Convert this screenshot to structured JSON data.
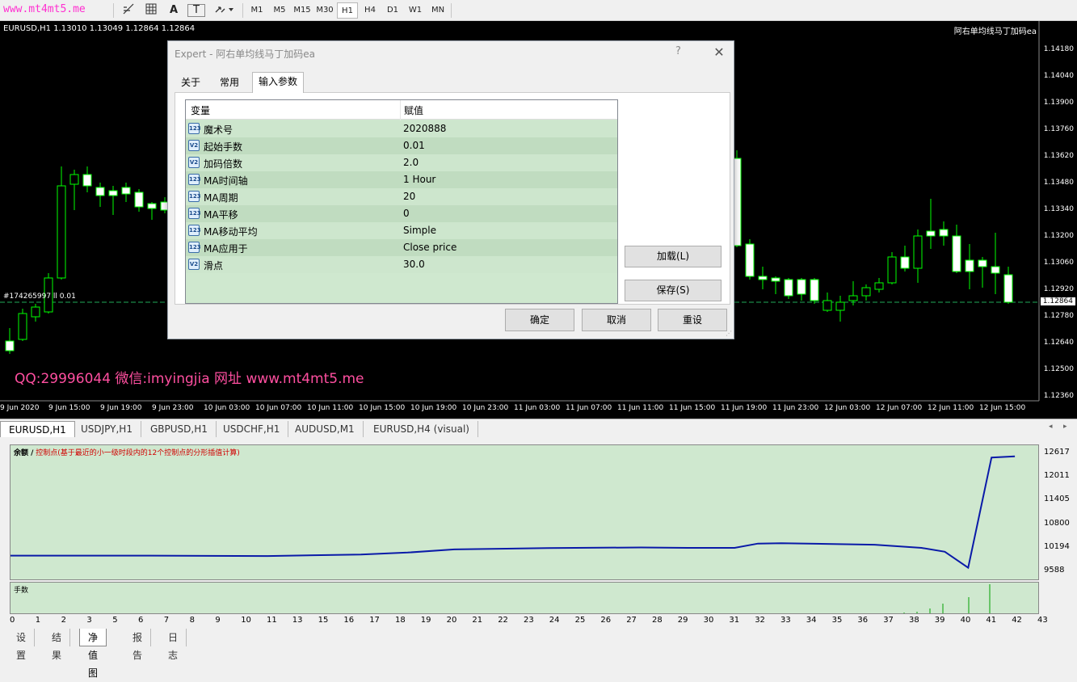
{
  "toolbar": {
    "watermark": "www.mt4mt5.me",
    "icons": [
      "fibonacci-icon",
      "grid-icon",
      "text-icon",
      "label-icon",
      "arrows-icon"
    ],
    "text_tool": "A",
    "label_tool": "T",
    "timeframes": [
      "M1",
      "M5",
      "M15",
      "M30",
      "H1",
      "H4",
      "D1",
      "W1",
      "MN"
    ],
    "active_timeframe": "H1"
  },
  "chart": {
    "info": "EURUSD,H1  1.13010 1.13049 1.12864 1.12864",
    "ea_name": "阿右单均线马丁加码ea",
    "order_label": "#174265997  ll 0.01",
    "promo": "QQ:29996044 微信:imyingjia 网址 www.mt4mt5.me",
    "price_ticks": [
      "1.14180",
      "1.14040",
      "1.13900",
      "1.13760",
      "1.13620",
      "1.13480",
      "1.13340",
      "1.13200",
      "1.13060",
      "1.12920",
      "1.12780",
      "1.12640",
      "1.12500",
      "1.12360"
    ],
    "current_price": "1.12864",
    "time_ticks": [
      "9 Jun 2020",
      "9 Jun 15:00",
      "9 Jun 19:00",
      "9 Jun 23:00",
      "10 Jun 03:00",
      "10 Jun 07:00",
      "10 Jun 11:00",
      "10 Jun 15:00",
      "10 Jun 19:00",
      "10 Jun 23:00",
      "11 Jun 03:00",
      "11 Jun 07:00",
      "11 Jun 11:00",
      "11 Jun 15:00",
      "11 Jun 19:00",
      "11 Jun 23:00",
      "12 Jun 03:00",
      "12 Jun 07:00",
      "12 Jun 11:00",
      "12 Jun 15:00"
    ]
  },
  "chart_tabs": [
    "EURUSD,H1",
    "USDJPY,H1",
    "GBPUSD,H1",
    "USDCHF,H1",
    "AUDUSD,M1",
    "EURUSD,H4 (visual)"
  ],
  "active_chart_tab": "EURUSD,H1",
  "dialog": {
    "title": "Expert - 阿右单均线马丁加码ea",
    "help": "?",
    "tabs": [
      "关于",
      "常用",
      "输入参数"
    ],
    "active_tab": "输入参数",
    "columns": [
      "变量",
      "赋值"
    ],
    "params": [
      {
        "icon": "123",
        "name": "魔术号",
        "value": "2020888"
      },
      {
        "icon": "V2",
        "name": "起始手数",
        "value": "0.01"
      },
      {
        "icon": "V2",
        "name": "加码倍数",
        "value": "2.0"
      },
      {
        "icon": "123",
        "name": "MA时间轴",
        "value": "1 Hour"
      },
      {
        "icon": "123",
        "name": "MA周期",
        "value": "20"
      },
      {
        "icon": "123",
        "name": "MA平移",
        "value": "0"
      },
      {
        "icon": "123",
        "name": "MA移动平均",
        "value": "Simple"
      },
      {
        "icon": "123",
        "name": "MA应用于",
        "value": "Close price"
      },
      {
        "icon": "V2",
        "name": "滑点",
        "value": "30.0"
      }
    ],
    "load_button": "加载(L)",
    "save_button": "保存(S)",
    "ok_button": "确定",
    "cancel_button": "取消",
    "reset_button": "重设"
  },
  "tester": {
    "equity_label": "余额 /",
    "equity_note": "控制点(基于最近的小一级时段内的12个控制点的分形插值计算)",
    "lots_label": "手数",
    "y_ticks": [
      "12617",
      "12011",
      "11405",
      "10800",
      "10194",
      "9588"
    ],
    "x_ticks": [
      "0",
      "1",
      "2",
      "3",
      "5",
      "6",
      "7",
      "8",
      "9",
      "10",
      "11",
      "13",
      "15",
      "16",
      "17",
      "18",
      "19",
      "20",
      "21",
      "22",
      "23",
      "24",
      "25",
      "26",
      "27",
      "28",
      "29",
      "30",
      "31",
      "32",
      "33",
      "34",
      "35",
      "36",
      "37",
      "38",
      "39",
      "40",
      "41",
      "42",
      "43"
    ],
    "tabs": [
      "设置",
      "结果",
      "净值图",
      "报告",
      "日志"
    ],
    "active_tab": "净值图"
  },
  "chart_data": {
    "type": "line",
    "ylim": [
      9588,
      12617
    ],
    "series": [
      {
        "x": [
          0,
          6,
          11,
          15,
          17,
          19,
          23,
          27,
          29,
          31,
          32,
          33,
          37,
          39,
          40,
          41,
          42,
          43
        ],
        "values": [
          9990,
          9990,
          9980,
          10020,
          10070,
          10150,
          10185,
          10200,
          10190,
          10190,
          10300,
          10310,
          10270,
          10190,
          10090,
          9680,
          12510,
          12540
        ]
      }
    ]
  }
}
